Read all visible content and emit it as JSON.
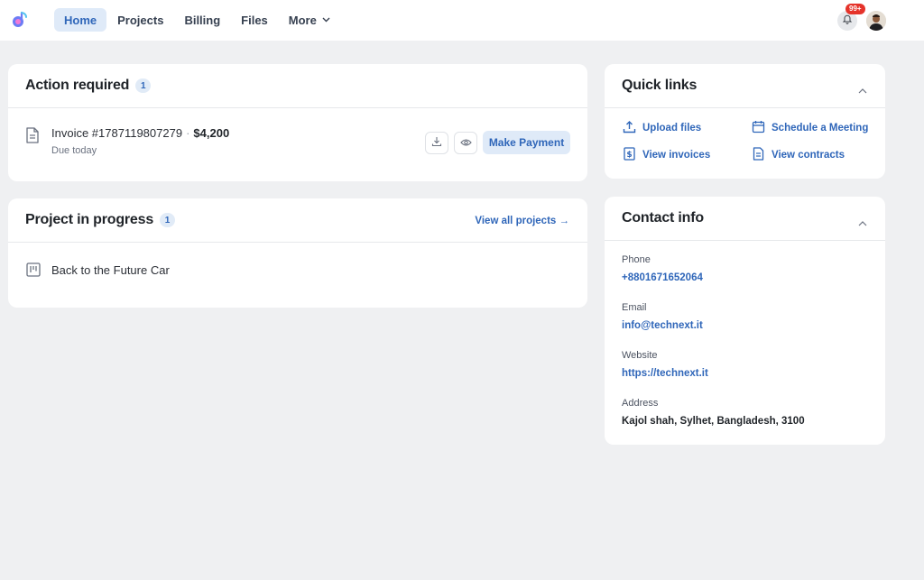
{
  "nav": {
    "items": [
      {
        "label": "Home",
        "active": true
      },
      {
        "label": "Projects"
      },
      {
        "label": "Billing"
      },
      {
        "label": "Files"
      },
      {
        "label": "More"
      }
    ],
    "notifications_badge": "99+"
  },
  "action_required": {
    "title": "Action required",
    "count": "1",
    "invoice": {
      "number": "Invoice #1787119807279",
      "separator": "·",
      "amount": "$4,200",
      "due": "Due today",
      "pay_label": "Make Payment"
    }
  },
  "project_in_progress": {
    "title": "Project in progress",
    "count": "1",
    "view_all": "View all projects →",
    "project_name": "Back to the Future Car"
  },
  "quick_links": {
    "title": "Quick links",
    "links": [
      {
        "label": "Upload files",
        "icon": "upload-icon"
      },
      {
        "label": "Schedule a Meeting",
        "icon": "calendar-icon"
      },
      {
        "label": "View invoices",
        "icon": "invoice-icon"
      },
      {
        "label": "View contracts",
        "icon": "contract-icon"
      }
    ]
  },
  "contact_info": {
    "title": "Contact info",
    "phone_label": "Phone",
    "phone": "+8801671652064",
    "email_label": "Email",
    "email": "info@technext.it",
    "website_label": "Website",
    "website": "https://technext.it",
    "address_label": "Address",
    "address": "Kajol shah, Sylhet, Bangladesh, 3100"
  },
  "colors": {
    "accent": "#2f66b9",
    "accent_bg": "#dfeaf8",
    "background": "#eff0f2",
    "badge": "#e5332a"
  }
}
